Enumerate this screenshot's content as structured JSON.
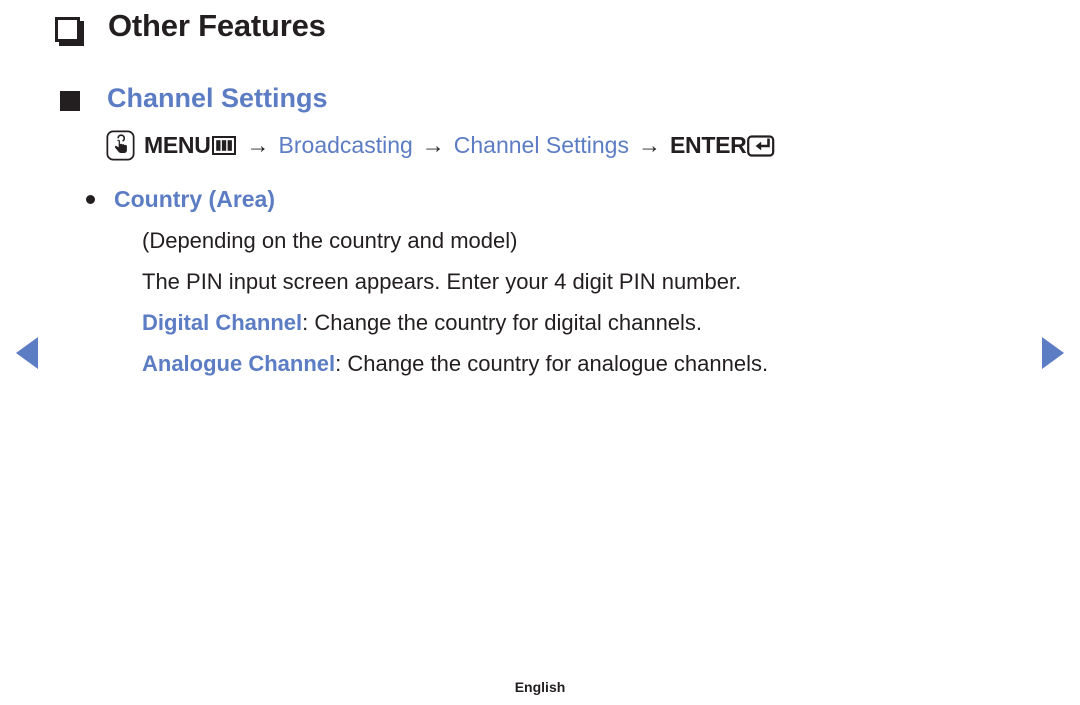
{
  "page": {
    "title": "Other Features",
    "section_heading": "Channel Settings",
    "accent_blue": "#5c7cc4",
    "text_black": "#231f20",
    "background": "#ffffff"
  },
  "menu_path": {
    "touch_icon": "touch-press-icon",
    "menu_label": "MENU",
    "menu_glyph": "menu-panel-icon",
    "arrow": "→",
    "items": [
      "Broadcasting",
      "Channel Settings"
    ],
    "enter_label": "ENTER",
    "enter_glyph": "enter-return-key-icon"
  },
  "content": {
    "bullet_label": "Country (Area)",
    "note": "(Depending on the country and model)",
    "pin_line": "The PIN input screen appears. Enter your 4 digit PIN number.",
    "digital": {
      "keyword": "Digital Channel",
      "description": ": Change the country for digital channels."
    },
    "analogue": {
      "keyword": "Analogue Channel",
      "description": ": Change the country for analogue channels."
    }
  },
  "navigation": {
    "previous_page": "previous-page-arrow",
    "next_page": "next-page-arrow"
  },
  "footer": {
    "language": "English"
  }
}
